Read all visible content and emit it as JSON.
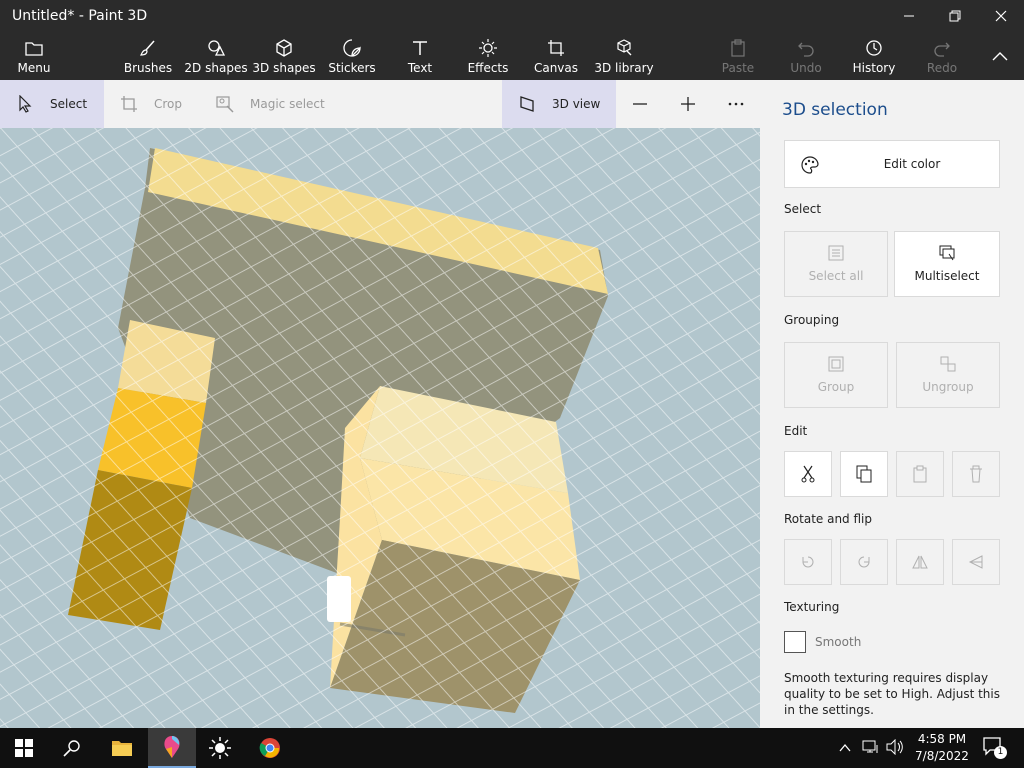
{
  "window": {
    "title": "Untitled* - Paint 3D"
  },
  "ribbon": {
    "menu": "Menu",
    "tools": [
      {
        "label": "Brushes",
        "icon": "brush-icon"
      },
      {
        "label": "2D shapes",
        "icon": "2d-shapes-icon"
      },
      {
        "label": "3D shapes",
        "icon": "3d-shapes-icon"
      },
      {
        "label": "Stickers",
        "icon": "stickers-icon"
      },
      {
        "label": "Text",
        "icon": "text-icon"
      },
      {
        "label": "Effects",
        "icon": "effects-icon"
      },
      {
        "label": "Canvas",
        "icon": "canvas-icon"
      },
      {
        "label": "3D library",
        "icon": "3d-library-icon"
      }
    ],
    "paste": "Paste",
    "undo": "Undo",
    "history": "History",
    "redo": "Redo"
  },
  "subbar": {
    "select": "Select",
    "crop": "Crop",
    "magic_select": "Magic select",
    "view_3d": "3D view"
  },
  "panel": {
    "title": "3D selection",
    "edit_color": "Edit color",
    "select_label": "Select",
    "select_all": "Select all",
    "multiselect": "Multiselect",
    "grouping_label": "Grouping",
    "group": "Group",
    "ungroup": "Ungroup",
    "edit_label": "Edit",
    "rotate_label": "Rotate and flip",
    "texturing_label": "Texturing",
    "smooth": "Smooth",
    "smooth_note": "Smooth texturing requires display quality to be set to High. Adjust this in the settings."
  },
  "taskbar": {
    "time": "4:58 PM",
    "date": "7/8/2022",
    "notifications": "1"
  },
  "colors": {
    "accent": "#1c4d8c",
    "chrome": "#2b2b2b",
    "panel": "#f2f2f2",
    "ground": "#b2c6cd"
  }
}
